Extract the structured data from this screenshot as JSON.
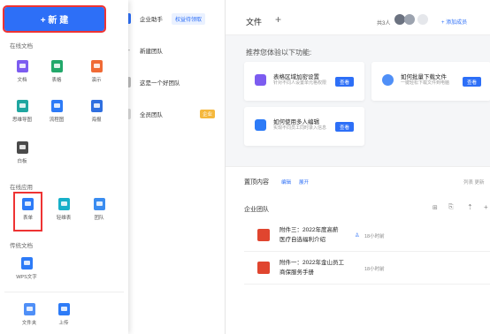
{
  "sidebar": {
    "new_label": "+ 新 建",
    "online_docs": "在线文档",
    "docs": [
      {
        "label": "文档",
        "color": "#7c5cf0"
      },
      {
        "label": "表格",
        "color": "#22a86a"
      },
      {
        "label": "演示",
        "color": "#f06a35"
      },
      {
        "label": "思维导图",
        "color": "#1fa6a0"
      },
      {
        "label": "流程图",
        "color": "#2d7bf7"
      },
      {
        "label": "海报",
        "color": "#2f6fe0"
      },
      {
        "label": "白板",
        "color": "#4a4a4a"
      }
    ],
    "online_apps": "在线应用",
    "apps": [
      {
        "label": "表单",
        "color": "#2d7bf7"
      },
      {
        "label": "轻维表",
        "color": "#17b0c9"
      },
      {
        "label": "团队",
        "color": "#3a8cf0"
      }
    ],
    "legacy_docs": "传统文档",
    "legacy": [
      {
        "label": "WPS文字",
        "color": "#2d7bf7"
      }
    ],
    "bottom": [
      {
        "label": "文件夹",
        "color": "#4f8ff7"
      },
      {
        "label": "上传",
        "color": "#2d7bf7"
      }
    ]
  },
  "list": {
    "items": [
      {
        "label": "企业助手",
        "tag": "权益待领取"
      },
      {
        "label": "新建团队"
      },
      {
        "label": "这是一个好团队"
      },
      {
        "label": "全员团队",
        "tag": "企业"
      }
    ]
  },
  "main": {
    "tab_files": "文件",
    "add_tab": "+",
    "member_count": "共3人",
    "add_member": "+ 添加成员",
    "recommend_title": "推荐您体验以下功能:",
    "features": [
      {
        "title": "表格区域加密设置",
        "desc": "针对不同人设置单元格权限",
        "action": "查看",
        "color": "#7c5cf0"
      },
      {
        "title": "如何批量下载文件",
        "desc": "一键轻松下载文件到电脑",
        "action": "查看",
        "color": "#4f8ff7"
      },
      {
        "title": "如何使用多人编辑",
        "desc": "实现不同员工同时录入信息",
        "action": "查看",
        "color": "#2d7bf7"
      }
    ],
    "pinned_title": "置顶内容",
    "pinned_edit": "编辑",
    "pinned_expand": "展开",
    "pinned_right": "列表 更新",
    "team_title": "企业团队",
    "files": [
      {
        "name": "附件三：2022年度高薪医疗自选福利介绍",
        "name_l1": "附件三：2022年度高薪",
        "name_l2": "医疗自选福利介绍",
        "time": "18小时前"
      },
      {
        "name": "附件一：2022年金山员工商保服务手册",
        "name_l1": "附件一：2022年金山员工",
        "name_l2": "商保服务手册",
        "time": "18小时前"
      }
    ]
  }
}
